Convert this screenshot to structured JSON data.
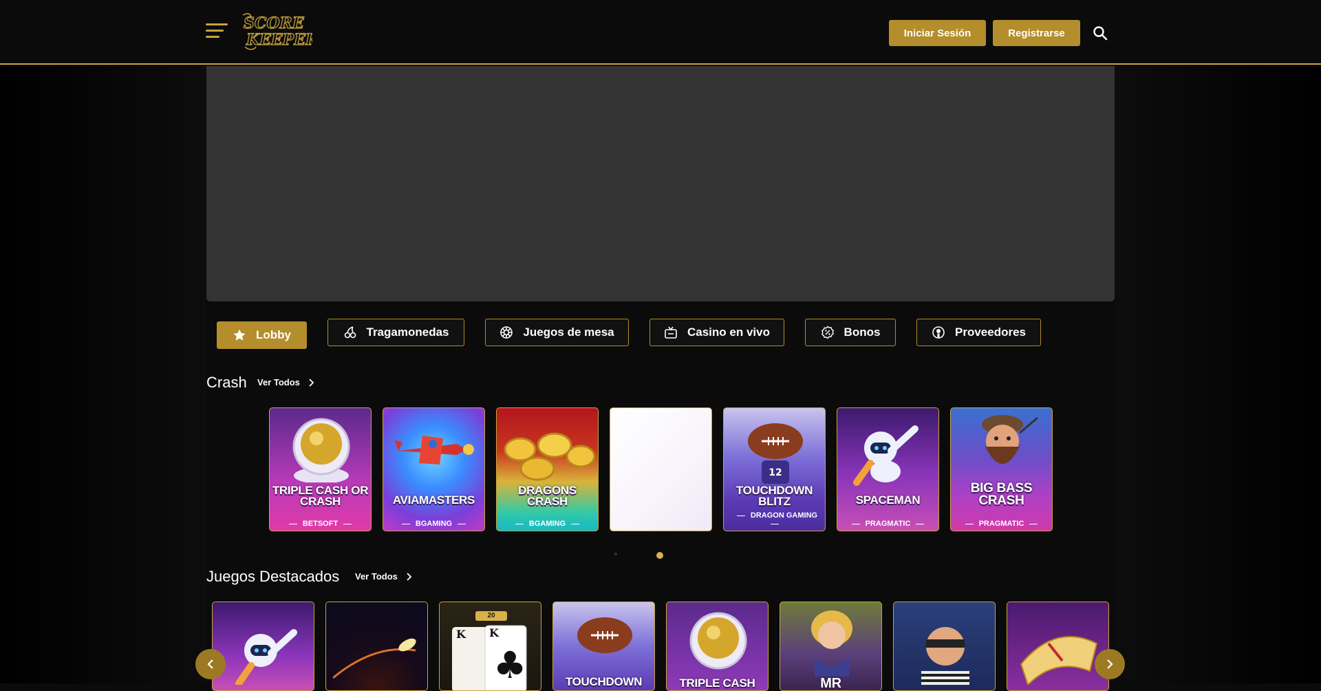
{
  "header": {
    "brand": "SCORE KEEPERS",
    "login_label": "Iniciar Sesión",
    "register_label": "Registrarse"
  },
  "colors": {
    "accent": "#b48d2c",
    "background": "#0b0b0b",
    "hero": "#333333"
  },
  "tabs": [
    {
      "label": "Lobby",
      "icon": "star-icon",
      "active": true
    },
    {
      "label": "Tragamonedas",
      "icon": "cherries-icon",
      "active": false
    },
    {
      "label": "Juegos de mesa",
      "icon": "poker-chip-icon",
      "active": false
    },
    {
      "label": "Casino en vivo",
      "icon": "tv-icon",
      "active": false
    },
    {
      "label": "Bonos",
      "icon": "percent-badge-icon",
      "active": false
    },
    {
      "label": "Proveedores",
      "icon": "user-circle-icon",
      "active": false
    }
  ],
  "crash": {
    "title": "Crash",
    "see_all": "Ver Todos",
    "games": [
      {
        "title": "TRIPLE CASH OR CRASH",
        "provider": "BETSOFT"
      },
      {
        "title": "AVIAMASTERS",
        "provider": "BGAMING"
      },
      {
        "title": "DRAGONS CRASH",
        "provider": "BGAMING"
      },
      {
        "title": "",
        "provider": ""
      },
      {
        "title": "TOUCHDOWN BLITZ",
        "provider": "DRAGON GAMING"
      },
      {
        "title": "SPACEMAN",
        "provider": "PRAGMATIC"
      },
      {
        "title": "BIG BASS CRASH",
        "provider": "PRAGMATIC"
      }
    ]
  },
  "featured": {
    "title": "Juegos Destacados",
    "see_all": "Ver Todos",
    "badge": "20",
    "card_text": [
      "",
      "",
      "",
      "TOUCHDOWN",
      "TRIPLE CASH",
      "MR",
      "",
      ""
    ]
  }
}
